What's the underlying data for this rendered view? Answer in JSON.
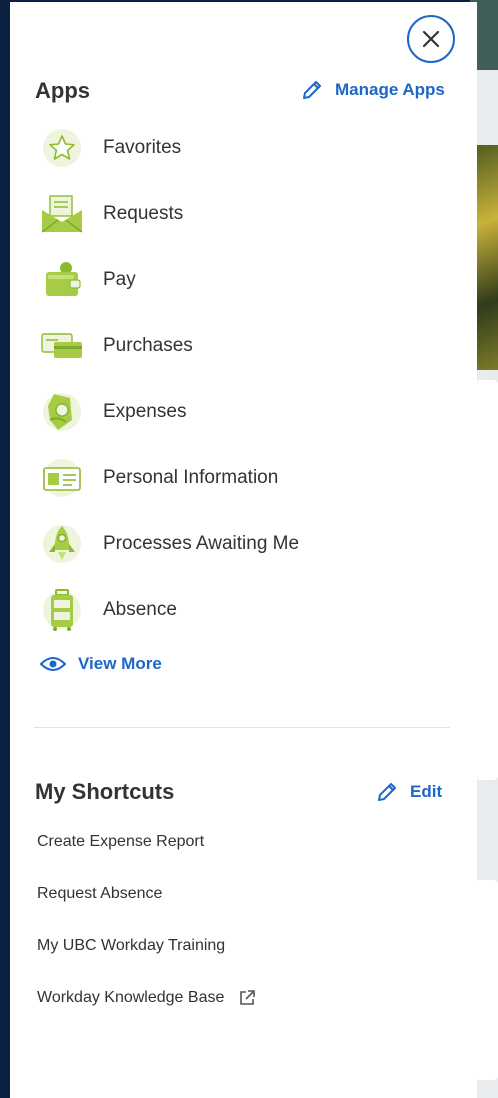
{
  "colors": {
    "accent": "#1e66c8",
    "icon_green": "#8dbb2e",
    "icon_bg": "#eef5dc",
    "text": "#333333"
  },
  "apps": {
    "title": "Apps",
    "manage_label": "Manage Apps",
    "items": [
      {
        "label": "Favorites",
        "icon": "star-icon"
      },
      {
        "label": "Requests",
        "icon": "envelope-icon"
      },
      {
        "label": "Pay",
        "icon": "wallet-icon"
      },
      {
        "label": "Purchases",
        "icon": "credit-cards-icon"
      },
      {
        "label": "Expenses",
        "icon": "money-hand-icon"
      },
      {
        "label": "Personal Information",
        "icon": "id-card-icon"
      },
      {
        "label": "Processes Awaiting Me",
        "icon": "rocket-icon"
      },
      {
        "label": "Absence",
        "icon": "suitcase-icon"
      }
    ],
    "view_more_label": "View More"
  },
  "shortcuts": {
    "title": "My Shortcuts",
    "edit_label": "Edit",
    "items": [
      {
        "label": "Create Expense Report"
      },
      {
        "label": "Request Absence"
      },
      {
        "label": "My UBC Workday Training"
      },
      {
        "label": "Workday Knowledge Base",
        "external": true
      }
    ]
  }
}
